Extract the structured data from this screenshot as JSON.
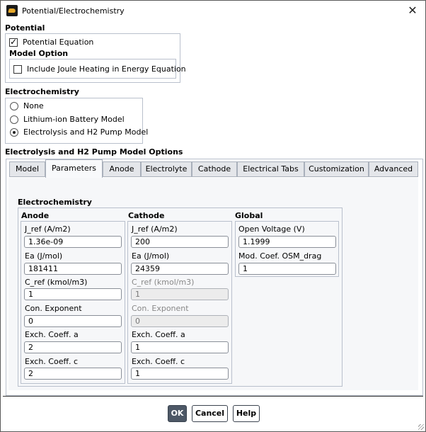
{
  "window": {
    "title": "Potential/Electrochemistry",
    "app_icon": "ansys-fluent-icon",
    "close_icon": "close-icon"
  },
  "potential": {
    "title": "Potential",
    "potential_equation": {
      "label": "Potential Equation",
      "checked": true
    },
    "model_option_title": "Model Option",
    "joule_heating": {
      "label": "Include Joule Heating in Energy Equation",
      "checked": false
    }
  },
  "electrochemistry": {
    "title": "Electrochemistry",
    "options": [
      {
        "label": "None",
        "selected": false
      },
      {
        "label": "Lithium-ion Battery Model",
        "selected": false
      },
      {
        "label": "Electrolysis and H2 Pump Model",
        "selected": true
      }
    ]
  },
  "model_options": {
    "title": "Electrolysis and H2 Pump Model Options",
    "tabs": [
      {
        "label": "Model",
        "active": false
      },
      {
        "label": "Parameters",
        "active": true
      },
      {
        "label": "Anode",
        "active": false
      },
      {
        "label": "Electrolyte",
        "active": false
      },
      {
        "label": "Cathode",
        "active": false
      },
      {
        "label": "Electrical Tabs",
        "active": false
      },
      {
        "label": "Customization",
        "active": false
      },
      {
        "label": "Advanced",
        "active": false
      }
    ]
  },
  "parameters": {
    "title": "Electrochemistry",
    "anode": {
      "title": "Anode",
      "fields": [
        {
          "label": "J_ref (A/m2)",
          "value": "1.36e-09",
          "enabled": true
        },
        {
          "label": "Ea (J/mol)",
          "value": "181411",
          "enabled": true
        },
        {
          "label": "C_ref (kmol/m3)",
          "value": "1",
          "enabled": true
        },
        {
          "label": "Con. Exponent",
          "value": "0",
          "enabled": true
        },
        {
          "label": "Exch. Coeff. a",
          "value": "2",
          "enabled": true
        },
        {
          "label": "Exch. Coeff. c",
          "value": "2",
          "enabled": true
        }
      ]
    },
    "cathode": {
      "title": "Cathode",
      "fields": [
        {
          "label": "J_ref (A/m2)",
          "value": "200",
          "enabled": true
        },
        {
          "label": "Ea (J/mol)",
          "value": "24359",
          "enabled": true
        },
        {
          "label": "C_ref (kmol/m3)",
          "value": "1",
          "enabled": false
        },
        {
          "label": "Con. Exponent",
          "value": "0",
          "enabled": false
        },
        {
          "label": "Exch. Coeff. a",
          "value": "1",
          "enabled": true
        },
        {
          "label": "Exch. Coeff. c",
          "value": "1",
          "enabled": true
        }
      ]
    },
    "global": {
      "title": "Global",
      "fields": [
        {
          "label": "Open Voltage (V)",
          "value": "1.1999",
          "enabled": true
        },
        {
          "label": "Mod. Coef. OSM_drag",
          "value": "1",
          "enabled": true
        }
      ]
    }
  },
  "buttons": {
    "ok": "OK",
    "cancel": "Cancel",
    "help": "Help"
  }
}
